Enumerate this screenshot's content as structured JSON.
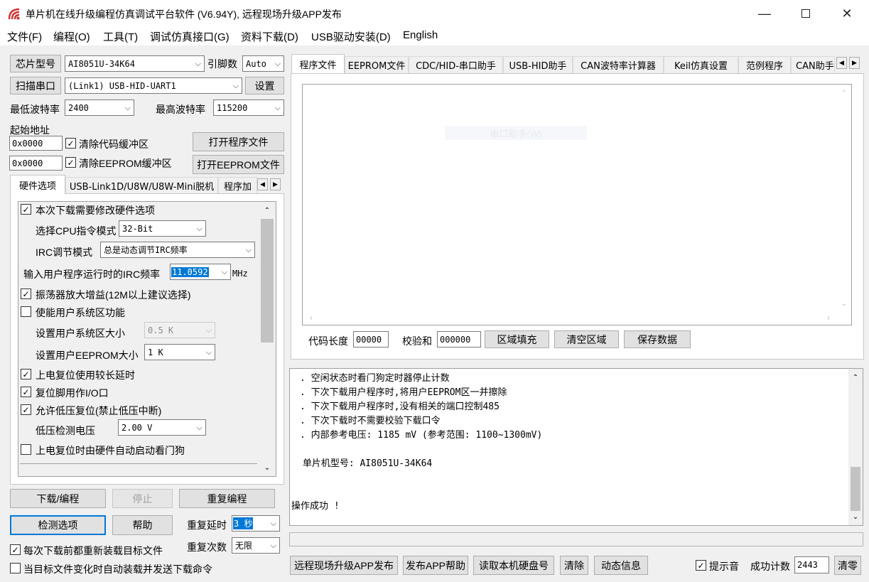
{
  "window": {
    "title": "单片机在线升级编程仿真调试平台软件 (V6.94Y), 远程现场升级APP发布"
  },
  "menu": [
    "文件(F)",
    "编程(O)",
    "工具(T)",
    "调试仿真接口(G)",
    "资料下载(D)",
    "USB驱动安装(D)",
    "English"
  ],
  "left": {
    "chip_button": "芯片型号",
    "chip_value": "AI8051U-34K64",
    "pin_label": "引脚数",
    "pin_value": "Auto",
    "scan_button": "扫描串口",
    "port_value": "(Link1) USB-HID-UART1",
    "settings_button": "设置",
    "min_baud_label": "最低波特率",
    "min_baud_value": "2400",
    "max_baud_label": "最高波特率",
    "max_baud_value": "115200",
    "start_addr_label": "起始地址",
    "code_addr": "0x0000",
    "clear_code_label": "清除代码缓冲区",
    "open_prog_button": "打开程序文件",
    "eeprom_addr": "0x0000",
    "clear_eeprom_label": "清除EEPROM缓冲区",
    "open_eeprom_button": "打开EEPROM文件",
    "tabs": [
      "硬件选项",
      "USB-Link1D/U8W/U8W-Mini脱机",
      "程序加"
    ],
    "options": {
      "modify_hw": "本次下载需要修改硬件选项",
      "cpu_mode_label": "选择CPU指令模式",
      "cpu_mode_value": "32-Bit",
      "irc_adj_label": "IRC调节模式",
      "irc_adj_value": "总是动态调节IRC频率",
      "irc_freq_label": "输入用户程序运行时的IRC频率",
      "irc_freq_value": "11.0592",
      "irc_freq_unit": "MHz",
      "osc_gain": "振荡器放大增益(12M以上建议选择)",
      "user_sys": "使能用户系统区功能",
      "user_sys_size_label": "设置用户系统区大小",
      "user_sys_size_value": "0.5 K",
      "user_eeprom_label": "设置用户EEPROM大小",
      "user_eeprom_value": "1   K",
      "long_delay": "上电复位使用较长延时",
      "reset_io": "复位脚用作I/O口",
      "lvr": "允许低压复位(禁止低压中断)",
      "lvd_label": "低压检测电压",
      "lvd_value": "2.00 V",
      "wdt": "上电复位时由硬件自动启动看门狗"
    },
    "download_button": "下载/编程",
    "stop_button": "停止",
    "repeat_button": "重复编程",
    "check_button": "检测选项",
    "help_button": "帮助",
    "repeat_delay_label": "重复延时",
    "repeat_delay_value": "3 秒",
    "repeat_count_label": "重复次数",
    "repeat_count_value": "无限",
    "reload_label": "每次下载前都重新装载目标文件",
    "auto_label": "当目标文件变化时自动装载并发送下载命令"
  },
  "right": {
    "tabs": [
      "程序文件",
      "EEPROM文件",
      "CDC/HID-串口助手",
      "USB-HID助手",
      "CAN波特率计算器",
      "Keil仿真设置",
      "范例程序",
      "CAN助手"
    ],
    "ghost_text": "串口助手(W)",
    "code_len_label": "代码长度",
    "code_len_value": "00000",
    "checksum_label": "校验和",
    "checksum_value": "000000",
    "fill_button": "区域填充",
    "clear_area_button": "清空区域",
    "save_button": "保存数据",
    "log": [
      ". 空闲状态时看门狗定时器停止计数",
      ". 下次下载用户程序时,将用户EEPROM区一并擦除",
      ". 下次下载用户程序时,没有相关的端口控制485",
      ". 下次下载时不需要校验下载口令",
      ". 内部参考电压: 1185 mV (参考范围: 1100~1300mV)",
      "",
      " 单片机型号: AI8051U-34K64",
      "",
      "",
      "操作成功 !"
    ],
    "bottom": {
      "remote_button": "远程现场升级APP发布",
      "app_help_button": "发布APP帮助",
      "read_disk_button": "读取本机硬盘号",
      "clear_button": "清除",
      "dynamic_button": "动态信息",
      "sound_label": "提示音",
      "success_label": "成功计数",
      "success_value": "2443",
      "reset_button": "清零"
    }
  },
  "colors": {
    "accent": "#0078d7",
    "logo": "#d32f2f"
  }
}
